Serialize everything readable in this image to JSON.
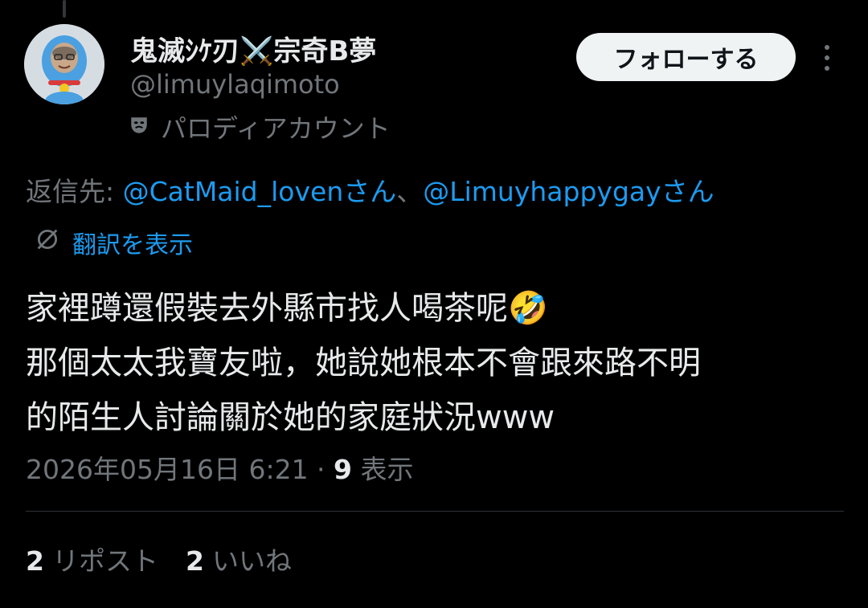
{
  "author": {
    "display_name": "鬼滅ｼｹ刃⚔️宗奇B夢",
    "handle": "@limuylaqimoto",
    "parody_label": "パロディアカウント"
  },
  "actions": {
    "follow_label": "フォローする"
  },
  "reply": {
    "prefix": "返信先: ",
    "mention_1": "@CatMaid_lovenさん",
    "separator": "、",
    "mention_2": "@Limuyhappygayさん"
  },
  "translate": {
    "label": "翻訳を表示"
  },
  "tweet": {
    "lines": [
      "家裡蹲還假裝去外縣市找人喝茶呢🤣",
      "那個太太我寶友啦，她說她根本不會跟來路不明",
      "的陌生人討論關於她的家庭狀況www"
    ]
  },
  "meta": {
    "timestamp": "2026年05月16日 6:21",
    "separator": " · ",
    "views_count": "9",
    "views_label": " 表示"
  },
  "stats": {
    "reposts_count": "2",
    "reposts_label": "リポスト",
    "likes_count": "2",
    "likes_label": "いいね"
  },
  "colors": {
    "background": "#000000",
    "text_primary": "#e7e9ea",
    "text_secondary": "#71767b",
    "accent": "#1d9bf0",
    "follow_button_bg": "#eff3f4",
    "divider": "#2f3336"
  },
  "icons": {
    "parody": "theater-mask-icon",
    "translate": "globe-slash-icon",
    "more": "more-vertical-icon"
  }
}
